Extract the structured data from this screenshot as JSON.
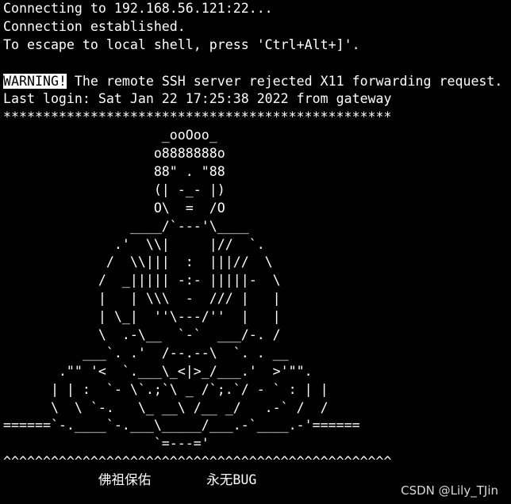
{
  "terminal": {
    "lines": [
      "Connecting to 192.168.56.121:22...",
      "Connection established.",
      "To escape to local shell, press 'Ctrl+Alt+]'.",
      "",
      "",
      "Last login: Sat Jan 22 17:25:38 2022 from gateway",
      "*************************************************",
      "                    _ooOoo_",
      "                   o8888888o",
      "                   88\" . \"88",
      "                   (| -_- |)",
      "                   O\\  =  /O",
      "                ____/`---'\\____",
      "              .'  \\\\|     |//  `.",
      "             /  \\\\|||  :  |||//  \\",
      "            /  _||||| -:- |||||-  \\",
      "            |   | \\\\\\  -  /// |   |",
      "            | \\_|  ''\\---/''  |   |",
      "            \\  .-\\__  `-`  ___/-. /",
      "          ___`. .'  /--.--\\  `. . __",
      "       .\"\" '<  `.___\\_<|>_/___.'  >'\"\".",
      "      | | :  `- \\`.;`\\ _ /`;.`/ - ` : | |",
      "      \\  \\ `-.   \\_ __\\ /__ _/   .-` /  /",
      "======`-.____`-.___\\_____/___.-`____.-'======",
      "                   `=---='",
      "^^^^^^^^^^^^^^^^^^^^^^^^^^^^^^^^^^^^^^^^^^^^^^^^^"
    ],
    "warning_label": "WARNING!",
    "warning_text": " The remote SSH server rejected X11 forwarding request.",
    "blessing_line": "            佛祖保佑       永无BUG"
  },
  "watermark": {
    "text": "CSDN @Lily_TJin"
  }
}
